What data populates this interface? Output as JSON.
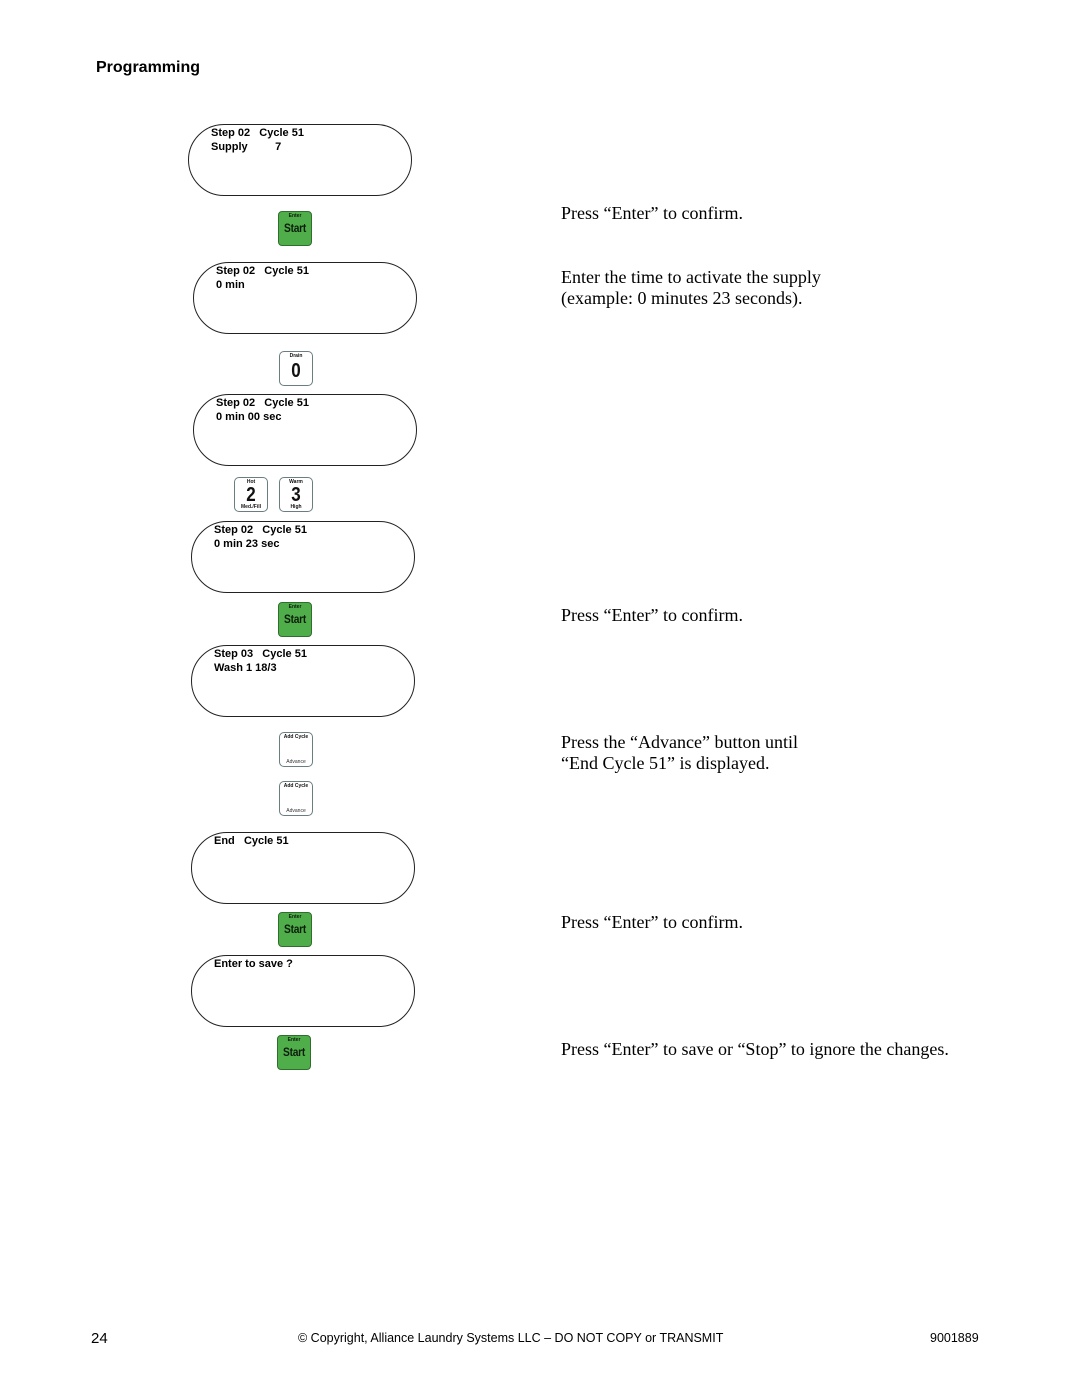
{
  "header": {
    "section_title": "Programming"
  },
  "displays": [
    {
      "line1": "Step 02   Cycle 51",
      "line2": "Supply         7"
    },
    {
      "line1": "Step 02   Cycle 51",
      "line2": "0 min"
    },
    {
      "line1": "Step 02   Cycle 51",
      "line2": "0 min 00 sec"
    },
    {
      "line1": "Step 02   Cycle 51",
      "line2": "0 min 23 sec"
    },
    {
      "line1": "Step 03   Cycle 51",
      "line2": "Wash 1 18/3"
    },
    {
      "line1": "End   Cycle 51",
      "line2": ""
    },
    {
      "line1": "Enter to save ?",
      "line2": ""
    }
  ],
  "buttons": {
    "start": {
      "top_label": "Enter",
      "main_label": "Start",
      "icon": "start-enter-button",
      "color": "#4fae4a"
    },
    "key_0": {
      "top_label": "Drain",
      "main_label": "0"
    },
    "key_2": {
      "top_label": "Hot",
      "main_label": "2",
      "bottom_label": "Med./Fill"
    },
    "key_3": {
      "top_label": "Warm",
      "main_label": "3",
      "bottom_label": "High"
    },
    "advance": {
      "top_label": "Add Cycle",
      "bottom_label": "Advance"
    }
  },
  "instructions": [
    "Press “Enter” to confirm.",
    "Enter the time to activate the supply\n(example: 0 minutes 23 seconds).",
    "Press “Enter” to confirm.",
    "Press the “Advance” button until\n“End Cycle 51” is displayed.",
    "Press “Enter” to confirm.",
    "Press “Enter” to save or “Stop” to ignore the changes."
  ],
  "footer": {
    "page_number": "24",
    "copyright": "© Copyright, Alliance Laundry Systems LLC – DO NOT COPY or TRANSMIT",
    "doc_number": "9001889"
  }
}
